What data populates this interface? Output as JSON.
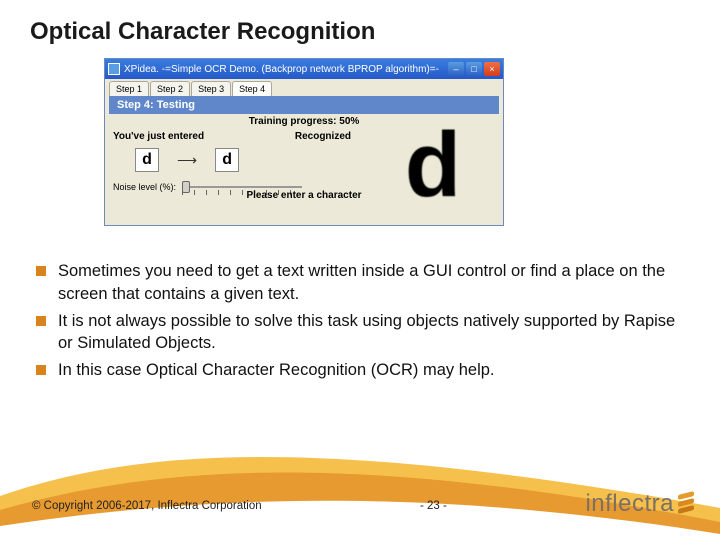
{
  "title": "Optical Character Recognition",
  "ocr": {
    "window_title": "XPidea. -=Simple OCR Demo. (Backprop network BPROP algorithm)=-",
    "tabs": [
      "Step 1",
      "Step 2",
      "Step 3",
      "Step 4"
    ],
    "step_banner": "Step 4: Testing",
    "progress": "Training progress: 50%",
    "entered_label": "You've just entered",
    "recognized_label": "Recognized",
    "entered_char": "d",
    "recognized_char": "d",
    "noise_label": "Noise level (%):",
    "large_char": "d",
    "prompt": "Please enter a character"
  },
  "bullets": [
    "Sometimes you need to get a text written inside a GUI control or find a place on the screen that contains a given text.",
    "It is not always possible to solve this task using objects natively supported by Rapise or Simulated Objects.",
    "In this case Optical Character Recognition (OCR) may help."
  ],
  "footer": {
    "copyright": "© Copyright 2006-2017, Inflectra Corporation",
    "page": "- 23 -",
    "logo_text": "inflectra"
  }
}
